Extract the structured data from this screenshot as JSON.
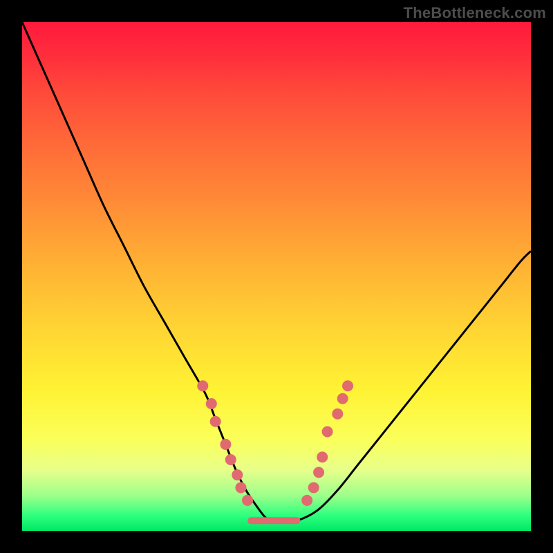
{
  "watermark": "TheBottleneck.com",
  "chart_data": {
    "type": "line",
    "title": "",
    "xlabel": "",
    "ylabel": "",
    "xlim": [
      0,
      100
    ],
    "ylim": [
      0,
      100
    ],
    "grid": false,
    "legend": false,
    "background_gradient": {
      "direction": "vertical",
      "stops": [
        {
          "pos": 0.0,
          "color": "#ff1a3c"
        },
        {
          "pos": 0.24,
          "color": "#ff6a38"
        },
        {
          "pos": 0.48,
          "color": "#ffb234"
        },
        {
          "pos": 0.72,
          "color": "#fff233"
        },
        {
          "pos": 0.93,
          "color": "#9eff8b"
        },
        {
          "pos": 1.0,
          "color": "#00e765"
        }
      ]
    },
    "series": [
      {
        "name": "bottleneck-curve",
        "style": "line",
        "color": "#000000",
        "x": [
          0,
          4,
          8,
          12,
          16,
          20,
          24,
          28,
          32,
          36,
          38,
          40,
          42,
          44,
          46,
          48,
          50,
          52,
          54,
          58,
          62,
          66,
          70,
          74,
          78,
          82,
          86,
          90,
          94,
          98,
          100
        ],
        "y": [
          100,
          91,
          82,
          73,
          64,
          56,
          48,
          41,
          34,
          27,
          22,
          17,
          12,
          8,
          5,
          2.5,
          2,
          2,
          2,
          4,
          8,
          13,
          18,
          23,
          28,
          33,
          38,
          43,
          48,
          53,
          55
        ]
      },
      {
        "name": "left-markers",
        "style": "scatter",
        "color": "#e06a6f",
        "x": [
          35.5,
          37.2,
          38.0,
          40.0,
          41.0,
          42.3,
          43.0,
          44.3
        ],
        "y": [
          28.5,
          25.0,
          21.5,
          17.0,
          14.0,
          11.0,
          8.5,
          6.0
        ]
      },
      {
        "name": "right-markers",
        "style": "scatter",
        "color": "#e06a6f",
        "x": [
          56.0,
          57.3,
          58.3,
          59.0,
          60.0,
          62.0,
          63.0,
          64.0
        ],
        "y": [
          6.0,
          8.5,
          11.5,
          14.5,
          19.5,
          23.0,
          26.0,
          28.5
        ],
        "note": "approximate visual positions of small pink dots"
      },
      {
        "name": "flat-bottom",
        "style": "scatter",
        "color": "#e06a6f",
        "x": [
          45,
          46,
          47,
          48,
          49,
          50,
          51,
          52,
          53,
          54
        ],
        "y": [
          2,
          2,
          2,
          2,
          2,
          2,
          2,
          2,
          2,
          2
        ]
      }
    ]
  }
}
